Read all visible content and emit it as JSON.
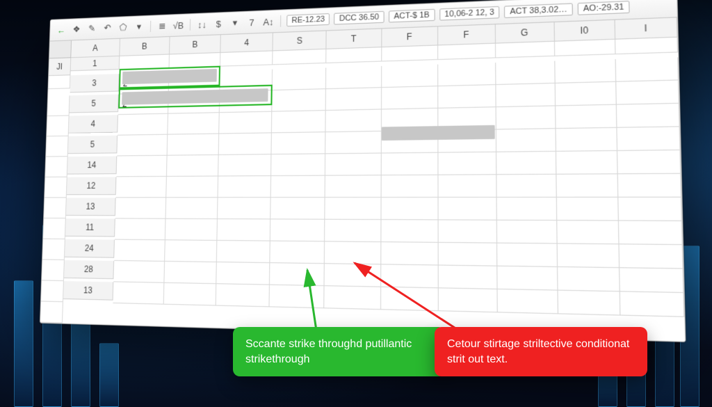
{
  "toolbar": {
    "icons": {
      "back": "←",
      "tag": "❖",
      "brush": "✎",
      "undo": "↶",
      "shape": "⬠",
      "dropdown": "▾",
      "list": "≣",
      "sqrt": "√B",
      "sort": "↕↓",
      "currency": "$",
      "filter": "▾",
      "seven": "7",
      "font": "A↕"
    },
    "chips": [
      "RE-12.23",
      "DCC 36.50",
      "ACT-$ 1B",
      "10,06-2 12, 3",
      "ACT 38,3.02…",
      "AO:-29.31"
    ]
  },
  "grid": {
    "columns": [
      "A",
      "B",
      "B",
      "4",
      "S",
      "T",
      "F",
      "F",
      "G",
      "I0",
      "I",
      "JI"
    ],
    "rows": [
      "1",
      "3",
      "5",
      "4",
      "5",
      "14",
      "12",
      "13",
      "11",
      "24",
      "28",
      "13"
    ],
    "cells": {
      "r1c0": "2",
      "r2c0": "2"
    }
  },
  "callouts": {
    "green": "Sccante strike throughd putillantic strikethrough",
    "red": "Cetour stirtage striltective conditionat strit out text."
  }
}
